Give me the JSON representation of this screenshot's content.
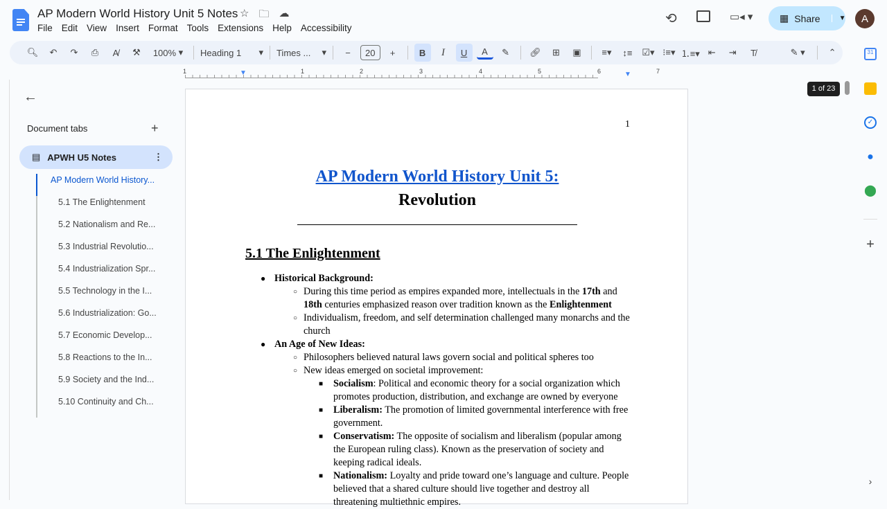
{
  "header": {
    "title": "AP Modern World History Unit 5 Notes",
    "menu": [
      "File",
      "Edit",
      "View",
      "Insert",
      "Format",
      "Tools",
      "Extensions",
      "Help",
      "Accessibility"
    ],
    "share_label": "Share",
    "avatar_initial": "A"
  },
  "toolbar": {
    "zoom": "100%",
    "style": "Heading 1",
    "font": "Times ...",
    "font_size": "20"
  },
  "ruler": {
    "labels": [
      "1",
      "1",
      "2",
      "3",
      "4",
      "5",
      "6",
      "7"
    ]
  },
  "sidebar": {
    "header": "Document tabs",
    "tab_name": "APWH U5 Notes",
    "outline": [
      "AP Modern World History...",
      "5.1 The Enlightenment",
      "5.2 Nationalism and Re...",
      "5.3 Industrial Revolutio...",
      "5.4 Industrialization Spr...",
      "5.5 Technology in the I...",
      "5.6 Industrialization: Go...",
      "5.7 Economic Develop...",
      "5.8 Reactions to the In...",
      "5.9 Society and the Ind...",
      "5.10 Continuity and Ch..."
    ]
  },
  "page_indicator": "1 of 23",
  "document": {
    "page_number": "1",
    "title_line1": "AP Modern World History Unit 5:",
    "title_line2": "Revolution",
    "heading": "5.1 The Enlightenment",
    "s1": {
      "label": "Historical Background:",
      "a1": "During this time period as empires expanded more, intellectuals in the ",
      "a2": "17th",
      "a3": " and ",
      "a4": "18th",
      "a5": " centuries emphasized reason over tradition known as the ",
      "a6": "Enlightenment",
      "b": "Individualism, freedom, and self determination challenged many monarchs and the church"
    },
    "s2": {
      "label": "An Age of New Ideas:",
      "a": "Philosophers believed natural laws govern social and political spheres too",
      "b": "New ideas emerged on societal improvement:",
      "items": [
        {
          "term": "Socialism",
          "text": ": Political and economic theory for a social organization which promotes production, distribution, and exchange are owned by everyone"
        },
        {
          "term": "Liberalism:",
          "text": " The promotion of limited governmental interference with free government."
        },
        {
          "term": "Conservatism:",
          "text": " The opposite of socialism and liberalism (popular among the European ruling class). Known as the preservation of society and keeping radical ideals."
        },
        {
          "term": "Nationalism:",
          "text": " Loyalty and pride toward one’s language and culture. People believed that a shared culture should live together and destroy all threatening multiethnic empires."
        }
      ]
    }
  }
}
